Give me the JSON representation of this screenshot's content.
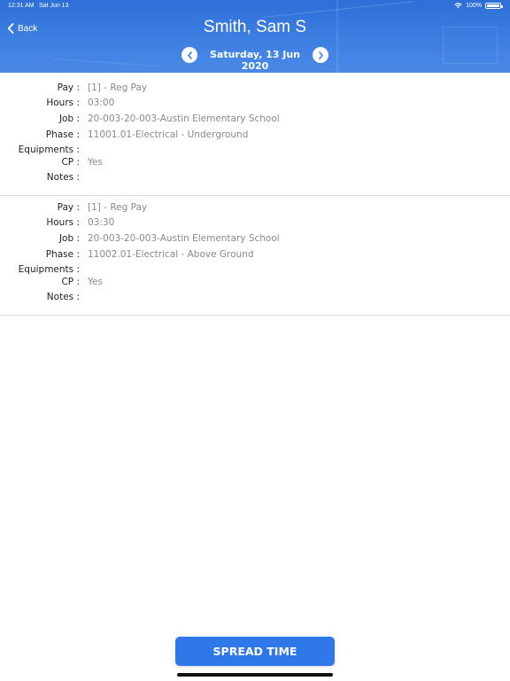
{
  "status_bar": {
    "time": "12:31 AM",
    "date": "Sat Jun 13",
    "battery": "100%"
  },
  "header": {
    "back_label": "Back",
    "title": "Smith, Sam S",
    "date": "Saturday, 13 Jun 2020",
    "background_color": "#3a7ce0"
  },
  "labels": {
    "pay": "Pay :",
    "hours": "Hours :",
    "job": "Job :",
    "phase": "Phase :",
    "equipments": "Equipments :",
    "cp": "CP :",
    "notes": "Notes :"
  },
  "entries": [
    {
      "pay": "[1] - Reg Pay",
      "hours": "03:00",
      "job": "20-003-20-003-Austin Elementary School",
      "phase": "11001.01-Electrical - Underground",
      "equipments": "",
      "cp": "Yes",
      "notes": ""
    },
    {
      "pay": "[1] - Reg Pay",
      "hours": "03:30",
      "job": "20-003-20-003-Austin Elementary School",
      "phase": "11002.01-Electrical - Above Ground",
      "equipments": "",
      "cp": "Yes",
      "notes": ""
    }
  ],
  "footer": {
    "spread_button_label": "SPREAD TIME",
    "button_color": "#2f78e9"
  },
  "icons": {
    "back": "chevron-left-icon",
    "prev_date": "chevron-left-icon",
    "next_date": "chevron-right-icon",
    "wifi": "wifi-icon",
    "battery": "battery-icon"
  }
}
